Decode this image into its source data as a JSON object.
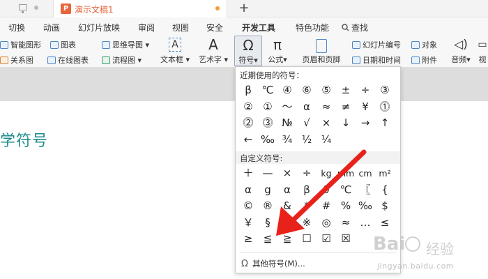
{
  "window": {
    "doc_title": "演示文稿1",
    "doc_icon_letter": "P",
    "new_tab": "+"
  },
  "menu": {
    "items": [
      "切换",
      "动画",
      "幻灯片放映",
      "审阅",
      "视图",
      "安全",
      "开发工具",
      "特色功能"
    ],
    "search": "查找",
    "search_icon": "search-icon"
  },
  "ribbon": {
    "smart_graphic": "智能图形",
    "chart": "图表",
    "mindmap": "思维导图",
    "relation": "关系图",
    "online_chart": "在线图表",
    "flowchart": "流程图",
    "textbox": "文本框",
    "wordart": "艺术字",
    "symbol": "符号",
    "formula": "公式",
    "header_footer": "页眉和页脚",
    "slide_number": "幻灯片编号",
    "object": "对象",
    "datetime": "日期和时间",
    "attachment": "附件",
    "audio": "音频",
    "video": "视"
  },
  "slide": {
    "visible_text": "学符号"
  },
  "symbol_panel": {
    "recent_title": "近期使用的符号：",
    "recent": [
      "β",
      "℃",
      "④",
      "⑥",
      "⑤",
      "±",
      "÷",
      "③",
      "②",
      "①",
      "～",
      "α",
      "≈",
      "≠",
      "¥",
      "⓵",
      "⓶",
      "⓷",
      "№",
      "√",
      "×",
      "↓",
      "→",
      "↑",
      "←",
      "‰",
      "¾",
      "½",
      "¼"
    ],
    "custom_title": "自定义符号:",
    "custom": [
      "＋",
      "—",
      "×",
      "÷",
      "kg",
      "mm",
      "cm",
      "m²",
      "α",
      "g",
      "α",
      "β",
      "θ",
      "℃",
      "〖",
      "{",
      "©",
      "®",
      "&",
      "*",
      "#",
      "%",
      "‰",
      "$",
      "￥",
      "§",
      "¦",
      "※",
      "◎",
      "≈",
      "…",
      "≤",
      "≥",
      "≦",
      "≧",
      "☐",
      "☑",
      "☒"
    ],
    "more": "其他符号(M)...",
    "more_icon": "omega-icon"
  },
  "colors": {
    "accent_orange": "#e8643b",
    "slide_text_teal": "#1a8a8a",
    "arrow_red": "#e8221b"
  },
  "watermark": {
    "brand": "Bai",
    "brand2": "经验",
    "url": "jingyan.baidu.com"
  }
}
